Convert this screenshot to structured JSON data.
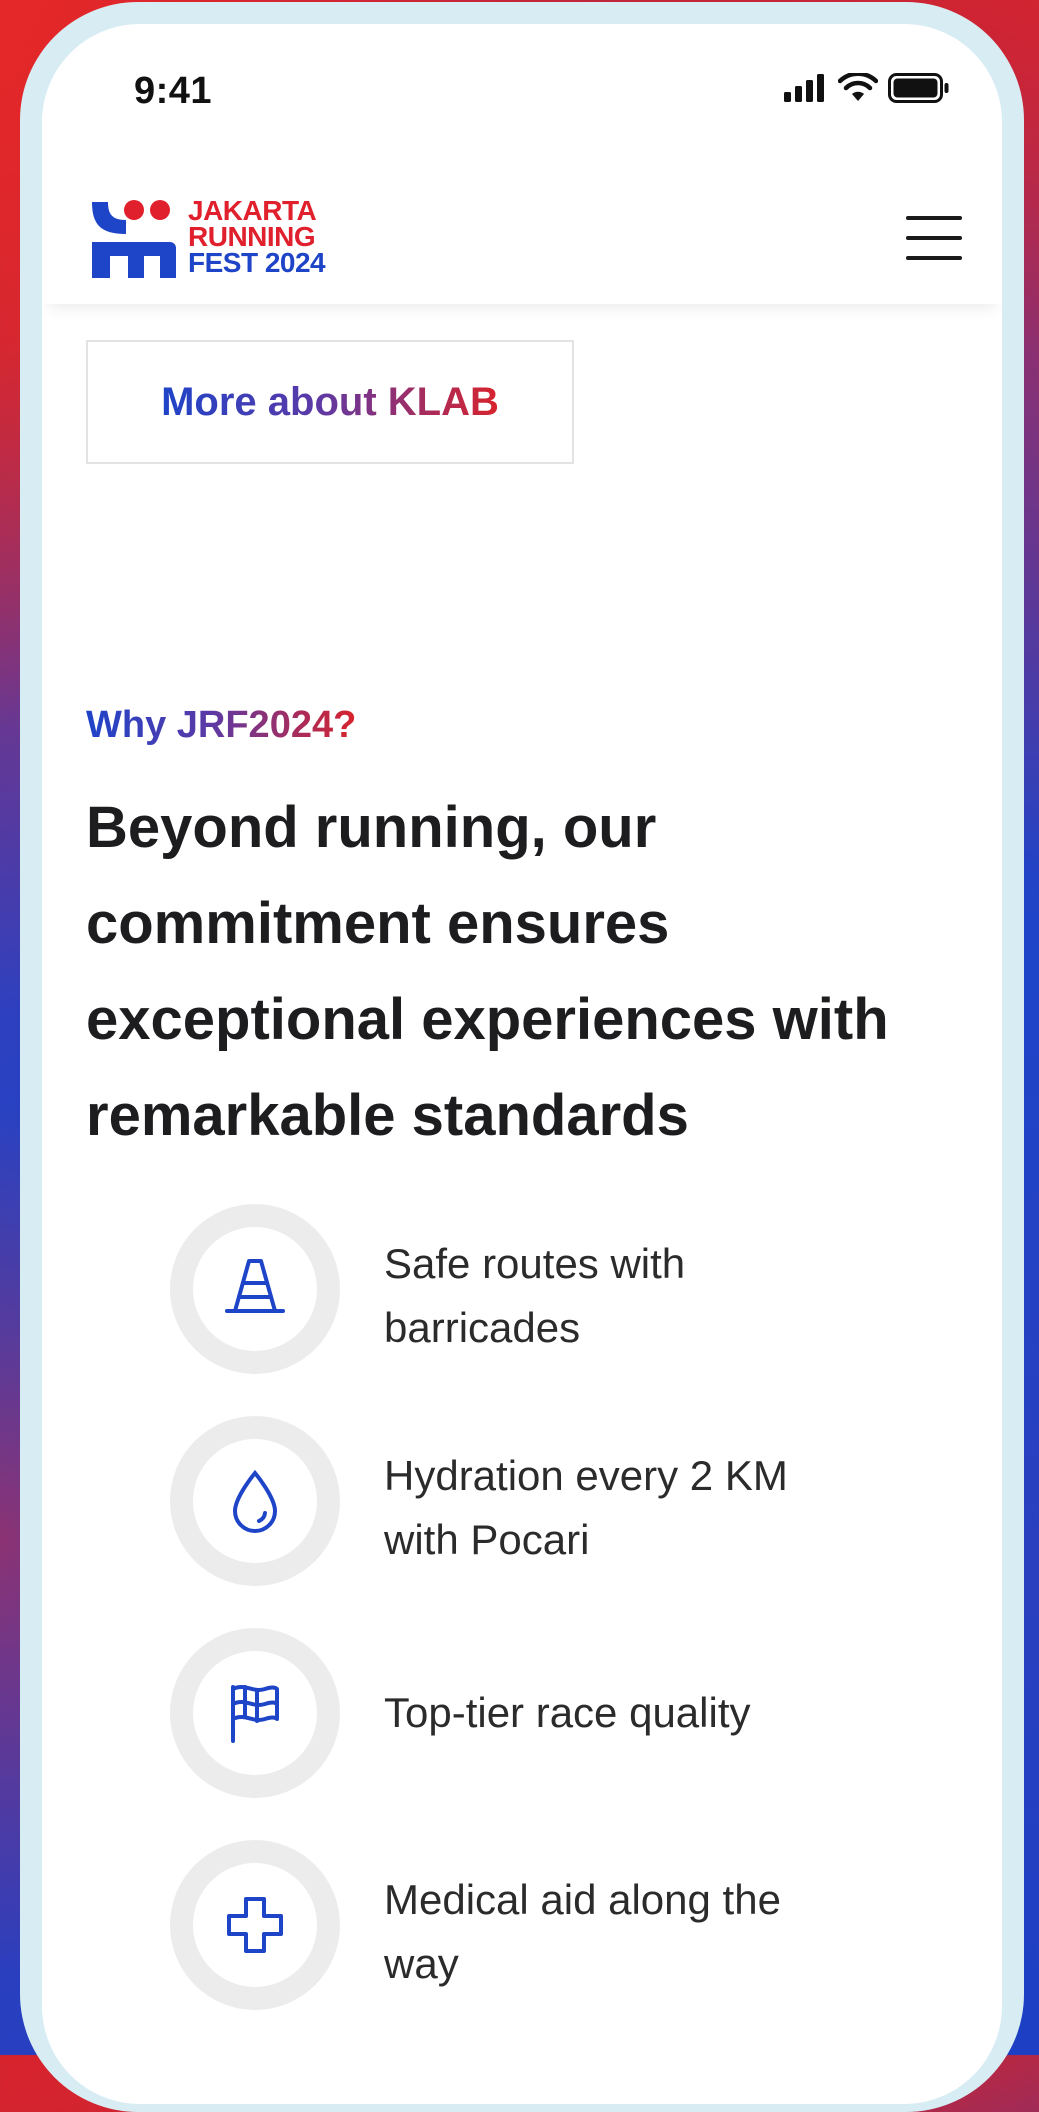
{
  "status_bar": {
    "time": "9:41"
  },
  "header": {
    "logo_lines": [
      "JAKARTA",
      "RUNNING",
      "FEST 2024"
    ],
    "brand_colors": {
      "red": "#e0202c",
      "blue": "#1e44c8"
    }
  },
  "klab_button": {
    "label": "More about KLAB"
  },
  "why": {
    "eyebrow": "Why JRF2024?",
    "headline": "Beyond running, our commitment ensures exceptional experiences with remarkable standards"
  },
  "features": [
    {
      "icon": "traffic-cone-icon",
      "label": "Safe routes with barricades"
    },
    {
      "icon": "water-drop-icon",
      "label": "Hydration every 2 KM with Pocari"
    },
    {
      "icon": "checkered-flag-icon",
      "label": "Top-tier race quality"
    },
    {
      "icon": "medical-cross-icon",
      "label": "Medical aid along the way"
    }
  ]
}
